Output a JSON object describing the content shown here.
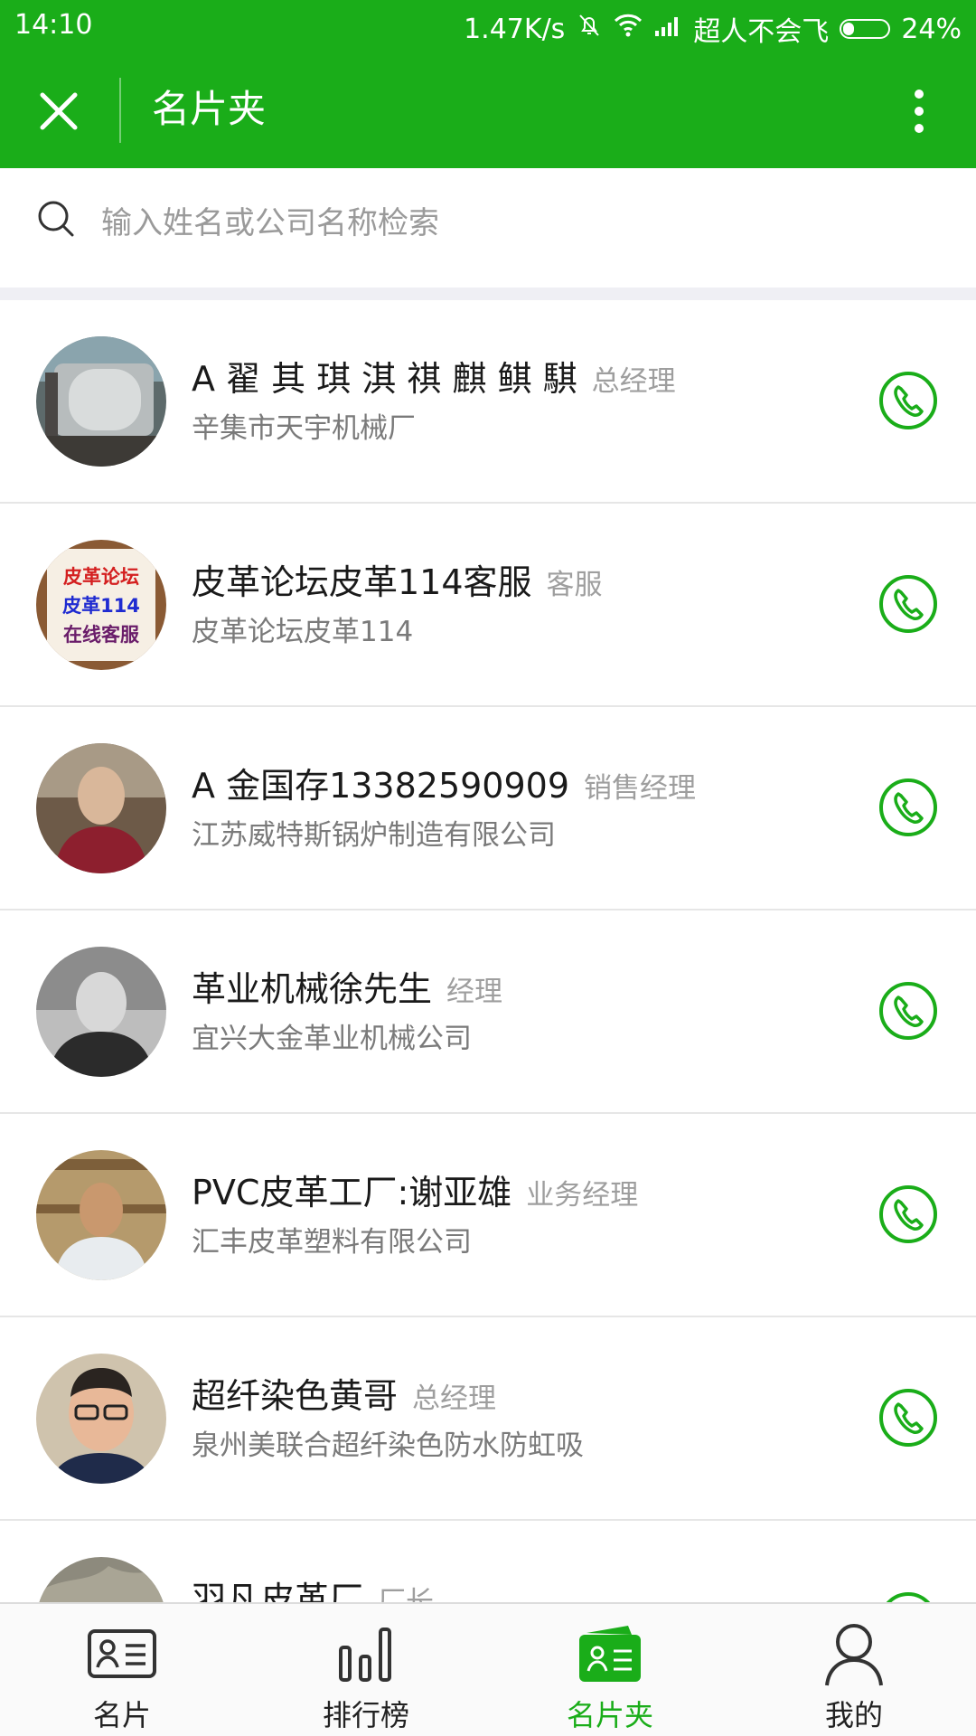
{
  "status_bar": {
    "time": "14:10",
    "net_speed": "1.47K/s",
    "carrier": "超人不会飞",
    "battery": "24%",
    "battery_level": 0.24
  },
  "header": {
    "title": "名片夹",
    "close_icon": "close-icon",
    "more_icon": "more-vertical-icon"
  },
  "search": {
    "placeholder": "输入姓名或公司名称检索"
  },
  "colors": {
    "brand_green": "#1aad19",
    "text_primary": "#1a1a1a",
    "text_secondary": "#7a7a7a",
    "text_muted": "#9e9e9e"
  },
  "contacts": [
    {
      "name": "A 翟 其 琪 淇 祺 麒 鲯 騏",
      "title": "总经理",
      "company": "辛集市天宇机械厂"
    },
    {
      "name": "皮革论坛皮革114客服",
      "title": "客服",
      "company": "皮革论坛皮革114",
      "avatar_text": [
        "皮革论坛",
        "皮革114",
        "在线客服"
      ]
    },
    {
      "name": "A 金国存13382590909",
      "title": "销售经理",
      "company": "江苏威特斯锅炉制造有限公司"
    },
    {
      "name": "革业机械徐先生",
      "title": "经理",
      "company": "宜兴大金革业机械公司"
    },
    {
      "name": "PVC皮革工厂:谢亚雄",
      "title": "业务经理",
      "company": "汇丰皮革塑料有限公司"
    },
    {
      "name": "超纤染色黄哥",
      "title": "总经理",
      "company": "泉州美联合超纤染色防水防虹吸"
    },
    {
      "name": "羽凡皮革厂",
      "title": "厂长",
      "company": ""
    }
  ],
  "bottom_nav": [
    {
      "label": "名片",
      "icon": "card-icon",
      "active": false
    },
    {
      "label": "排行榜",
      "icon": "ranking-icon",
      "active": false
    },
    {
      "label": "名片夹",
      "icon": "card-holder-icon",
      "active": true
    },
    {
      "label": "我的",
      "icon": "user-icon",
      "active": false
    }
  ]
}
